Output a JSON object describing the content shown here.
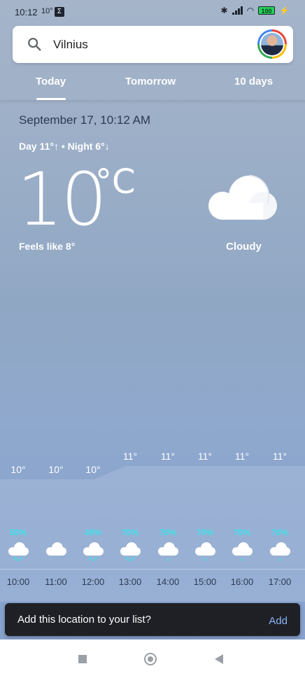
{
  "status_bar": {
    "time": "10:12",
    "temp": "10°",
    "battery": "100"
  },
  "search": {
    "query": "Vilnius"
  },
  "tabs": [
    {
      "label": "Today",
      "selected": true
    },
    {
      "label": "Tomorrow",
      "selected": false
    },
    {
      "label": "10 days",
      "selected": false
    }
  ],
  "current": {
    "datetime": "September 17, 10:12 AM",
    "day_night": "Day 11°↑ • Night 6°↓",
    "temperature": "10",
    "unit": "°C",
    "feels_like": "Feels like 8°",
    "condition": "Cloudy"
  },
  "hourly": [
    {
      "time": "10:00",
      "temp": "10°",
      "precip": "50%",
      "icon": "cloud-snow-icon"
    },
    {
      "time": "11:00",
      "temp": "10°",
      "precip": "",
      "icon": "cloud-icon"
    },
    {
      "time": "12:00",
      "temp": "10°",
      "precip": "40%",
      "icon": "cloud-snow-icon"
    },
    {
      "time": "13:00",
      "temp": "11°",
      "precip": "70%",
      "icon": "cloud-snow-icon"
    },
    {
      "time": "14:00",
      "temp": "11°",
      "precip": "70%",
      "icon": "cloud-rain-icon"
    },
    {
      "time": "15:00",
      "temp": "11°",
      "precip": "70%",
      "icon": "cloud-rain-icon"
    },
    {
      "time": "16:00",
      "temp": "11°",
      "precip": "70%",
      "icon": "cloud-rain-icon"
    },
    {
      "time": "17:00",
      "temp": "11°",
      "precip": "70%",
      "icon": "cloud-rain-icon"
    }
  ],
  "snackbar": {
    "message": "Add this location to your list?",
    "action": "Add"
  },
  "colors": {
    "precip": "#3fe0e8",
    "link": "#8ab4f8"
  }
}
